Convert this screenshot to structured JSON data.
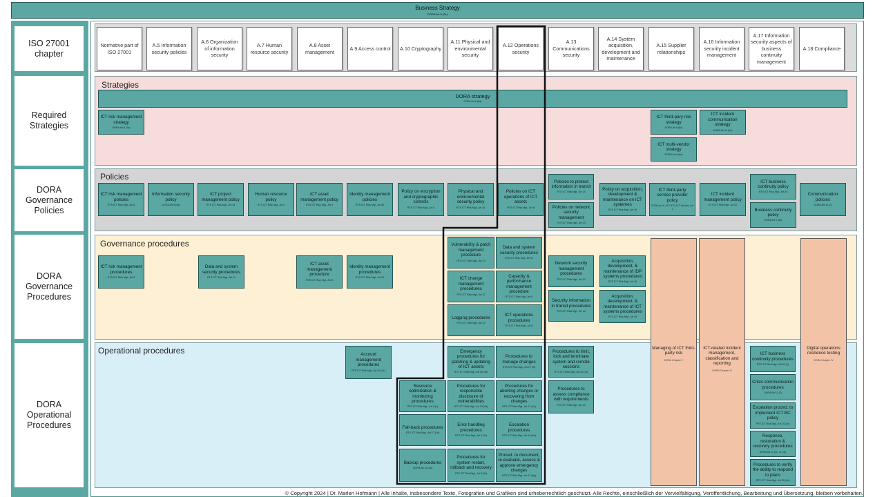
{
  "header": {
    "title": "Business Strategy",
    "ref": "DORA Art 5 (2e)"
  },
  "rows": [
    "ISO 27001 chapter",
    "Required Strategies",
    "DORA Governance Policies",
    "DORA Governance Procedures",
    "DORA Operational Procedures"
  ],
  "iso_chapters": [
    "Normative part of ISO 27001",
    "A.5 Information security policies",
    "A.6 Organization of information security",
    "A.7 Human resource security",
    "A.8 Asset management",
    "A.9 Access control",
    "A.10 Cryptography",
    "A.11 Physical and environmental security",
    "A.12 Operations security",
    "A.13 Communications security",
    "A.14 System acquisition, development and maintenance",
    "A.15 Supplier relationships",
    "A.16 Information security incident management",
    "A.17 Information security aspects of business continuity management",
    "A.18 Compliance"
  ],
  "sections": {
    "strategies": "Strategies",
    "policies": "Policies",
    "gov": "Governance procedures",
    "ops": "Operational procedures"
  },
  "strategies": [
    {
      "t": "DORA strategy",
      "r": "DORA Art 6 (8a)"
    },
    {
      "t": "ICT risk management strategy",
      "r": "DORA Art 6 (2a)"
    },
    {
      "t": "ICT third-pary risk strategy",
      "r": "DORA Art 6 (8c)"
    },
    {
      "t": "ICT incident communication strategy",
      "r": "DORA Art 14 (2a)"
    },
    {
      "t": "ICT multi-vendor strategy",
      "r": "DORA Art 6 (9a)"
    }
  ],
  "policies": [
    {
      "t": "ICT risk management policies",
      "r": "RTS ICT Risk Mgt., Art 3"
    },
    {
      "t": "Information security policy",
      "r": "DORA Art 9 (4a)"
    },
    {
      "t": "ICT project management policy",
      "r": "RTS ICT Risk Mgt., Art 15"
    },
    {
      "t": "Human resource policy",
      "r": "RTS ICT Risk Mgt., Art 3"
    },
    {
      "t": "ICT asset management policy",
      "r": "RTS ICT Risk Mgt., Art 4"
    },
    {
      "t": "Identity management policies",
      "r": "RTS ICT Risk Mgt., Art 20"
    },
    {
      "t": "Policy on encryption and cryptographic controls",
      "r": "RTS ICT Risk Mgt., Art 6"
    },
    {
      "t": "Physical and environmental security policy",
      "r": "RTS ICT Risk Mgt., Art 18"
    },
    {
      "t": "Policies on ICT operations of ICT assets",
      "r": "RTS ICT Risk Mgt., Art 8"
    },
    {
      "t": "Policies to protect information in transit",
      "r": "RTS ICT Risk Mgt., Art 14"
    },
    {
      "t": "Policies on network security management",
      "r": "RTS ICT Risk Mgt., Art 13"
    },
    {
      "t": "Policy on acquisition, development & maintenance on ICT systemes",
      "r": "RTS ICT Risk Mgt., Art 16"
    },
    {
      "t": "ICT third-party service provider policy",
      "r": "DORA Art 9, 28 / RTS ICT Service, Art 1"
    },
    {
      "t": "ICT incident management policy",
      "r": "RTS ICT Risk Mgt., Art 22"
    },
    {
      "t": "ICT business continuity policy",
      "r": "RTS ICT Risk Mgt., Art 24"
    },
    {
      "t": "Business continuity policy",
      "r": "DORA Art 9 (3a)"
    },
    {
      "t": "Communication policies",
      "r": "DORA Art 14 (2)"
    }
  ],
  "gov": [
    {
      "t": "ICT risk management procedures",
      "r": "RTS ICT Risk Mgt., Art 3"
    },
    {
      "t": "Data and system security procedures",
      "r": "RTS ICT Risk Mgt., Art 11"
    },
    {
      "t": "ICT asset management procedure",
      "r": "RTS ICT Risk Mgt., Art 5"
    },
    {
      "t": "Identity management procedures",
      "r": "RTS ICT Risk Mgt., Art 20"
    },
    {
      "t": "Vulnerability & patch management procedure",
      "r": "RTS ICT Risk Mgt., Art 10"
    },
    {
      "t": "Data and system security procedures",
      "r": "RTS ICT Risk Mgt., Art 11"
    },
    {
      "t": "ICT change management procedures",
      "r": "RTS ICT Risk Mgt., Art 17"
    },
    {
      "t": "Capacity & performance management procedure",
      "r": "RTS ICT Risk Mgt., Art 9"
    },
    {
      "t": "Logging procedures",
      "r": "RTS ICT Risk Mgt., Art 12"
    },
    {
      "t": "ICT operations procedures",
      "r": "RTS ICT Risk Mgt., Art 8"
    },
    {
      "t": "Network security management procedures",
      "r": "RTS ICT Risk Mgt., Art 13"
    },
    {
      "t": "Acquisition, development, & maintenance of IDP systems procedures",
      "r": "RTS ICT Risk Mgt., Art 16"
    },
    {
      "t": "Security information in transit procedures",
      "r": "RTS ICT Risk Mgt., Art 14"
    },
    {
      "t": "Acquisition, development, & maintenance of ICT systems procedures",
      "r": "RTS ICT Risk Mgt., Art 16"
    }
  ],
  "ops": [
    {
      "t": "Account management procedures",
      "r": "RTS ICT Risk Mgt., Art 21 (1e)"
    },
    {
      "t": "Emergency procedures for patching & updating of ICT assets",
      "r": "RTS ICT Risk Mgt., Art 10 (4b)"
    },
    {
      "t": "Procedures to manage changes",
      "r": "RTS ICT Risk Mgt., Art 17 (2f)"
    },
    {
      "t": "Procedures to limit, lock and terminate system and remote sessions",
      "r": "RTS ICT Risk Mgt., Art 13 (1c)"
    },
    {
      "t": "Resource optimization & monitoring procedures",
      "r": "RTS ICT Risk Mgt., Art 9 (1)"
    },
    {
      "t": "Procedures for responsible disclosure of vulnerabilities",
      "r": "RTS ICT Risk Mgt., Art 10 (2a)"
    },
    {
      "t": "Procedures for aborting changes or recovering from changes",
      "r": "RTS ICT Risk Mgt., Art 17 (2e)"
    },
    {
      "t": "Procedures to assess compliance with requirements",
      "r": "RTS ICT Risk Mgt., Art 14"
    },
    {
      "t": "Fall-back procedures",
      "r": "RTS ICT Risk Mgt., Art 17 (2e)"
    },
    {
      "t": "Error handling procedures",
      "r": "RTS ICT Risk Mgt., Art 8 (2c)"
    },
    {
      "t": "Escalation procedures",
      "r": "RTS ICT Risk Mgt., Art 10 (4d)"
    },
    {
      "t": "Backup procedures",
      "r": "DORA Art 12 (1a)"
    },
    {
      "t": "Procedures for system restart, rollback and recovery",
      "r": "RTS ICT Risk Mgt., Art 8 (2e)"
    },
    {
      "t": "Proced. to document, re-evaluate, assess & approve emergency changes",
      "r": "RTS ICT Risk Mgt., Art 17 (2g)"
    },
    {
      "t": "ICT business continuity procedures",
      "r": "RTS ICT Risk Mgt., Art 24 (1)"
    },
    {
      "t": "Crisis communication procedures",
      "r": "DORA Art 11 (2)"
    },
    {
      "t": "Escalation proced. to implement ICT BC policy",
      "r": "RTS ICT Risk Mgt., Art 24 (1e)"
    },
    {
      "t": "Response, restoration & recovery procedures",
      "r": "DORA Art 11 (2c, 11 (3))"
    },
    {
      "t": "Procedures to verify the ability to respond to plans",
      "r": "RTS ICT Risk Mgt., Art 25 (2e)"
    }
  ],
  "pillars": [
    {
      "t": "Managing of ICT third-party risk",
      "r": "DORA Chapter V"
    },
    {
      "t": "ICT-related incident management, classification and reporting",
      "r": "DORA Chapter III"
    },
    {
      "t": "Digital operations resilience testing",
      "r": "DORA Chapter IV"
    }
  ],
  "copyright": "© Copyright 2024 | Dr. Marlen Hofmann | Alle Inhalte, insbesondere Texte, Fotografien und Grafiken sind urheberrechtlich geschützt. Alle Rechte, einschließlich der Vervielfältigung, Veröffentlichung, Bearbeitung und Übersetzung, bleiben vorbehalten."
}
